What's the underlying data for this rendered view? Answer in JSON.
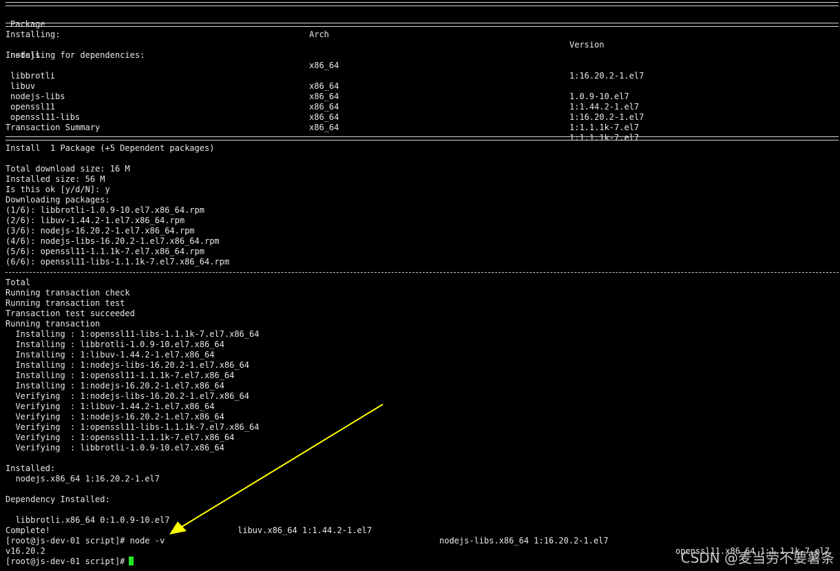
{
  "header": {
    "package": "Package",
    "arch": "Arch",
    "version": "Version"
  },
  "installing_label": "Installing:",
  "main_pkg": {
    "name": "nodejs",
    "arch": "x86_64",
    "version": "1:16.20.2-1.el7"
  },
  "deps_label": "Installing for dependencies:",
  "deps": [
    {
      "name": "libbrotli",
      "arch": "x86_64",
      "version": "1.0.9-10.el7"
    },
    {
      "name": "libuv",
      "arch": "x86_64",
      "version": "1:1.44.2-1.el7"
    },
    {
      "name": "nodejs-libs",
      "arch": "x86_64",
      "version": "1:16.20.2-1.el7"
    },
    {
      "name": "openssl11",
      "arch": "x86_64",
      "version": "1:1.1.1k-7.el7"
    },
    {
      "name": "openssl11-libs",
      "arch": "x86_64",
      "version": "1:1.1.1k-7.el7"
    }
  ],
  "txn_summary": "Transaction Summary",
  "install_line": "Install  1 Package (+5 Dependent packages)",
  "total_download": "Total download size: 16 M",
  "installed_size": "Installed size: 56 M",
  "is_ok": "Is this ok [y/d/N]: y",
  "downloading": "Downloading packages:",
  "downloads": [
    "(1/6): libbrotli-1.0.9-10.el7.x86_64.rpm",
    "(2/6): libuv-1.44.2-1.el7.x86_64.rpm",
    "(3/6): nodejs-16.20.2-1.el7.x86_64.rpm",
    "(4/6): nodejs-libs-16.20.2-1.el7.x86_64.rpm",
    "(5/6): openssl11-1.1.1k-7.el7.x86_64.rpm",
    "(6/6): openssl11-libs-1.1.1k-7.el7.x86_64.rpm"
  ],
  "total": "Total",
  "txn_lines": [
    "Running transaction check",
    "Running transaction test",
    "Transaction test succeeded",
    "Running transaction"
  ],
  "steps": [
    "  Installing : 1:openssl11-libs-1.1.1k-7.el7.x86_64",
    "  Installing : libbrotli-1.0.9-10.el7.x86_64",
    "  Installing : 1:libuv-1.44.2-1.el7.x86_64",
    "  Installing : 1:nodejs-libs-16.20.2-1.el7.x86_64",
    "  Installing : 1:openssl11-1.1.1k-7.el7.x86_64",
    "  Installing : 1:nodejs-16.20.2-1.el7.x86_64",
    "  Verifying  : 1:nodejs-libs-16.20.2-1.el7.x86_64",
    "  Verifying  : 1:libuv-1.44.2-1.el7.x86_64",
    "  Verifying  : 1:nodejs-16.20.2-1.el7.x86_64",
    "  Verifying  : 1:openssl11-libs-1.1.1k-7.el7.x86_64",
    "  Verifying  : 1:openssl11-1.1.1k-7.el7.x86_64",
    "  Verifying  : libbrotli-1.0.9-10.el7.x86_64"
  ],
  "installed_label": "Installed:",
  "installed_pkg": "  nodejs.x86_64 1:16.20.2-1.el7",
  "dep_installed_label": "Dependency Installed:",
  "dep_installed": [
    "  libbrotli.x86_64 0:1.0.9-10.el7",
    "libuv.x86_64 1:1.44.2-1.el7",
    "nodejs-libs.x86_64 1:16.20.2-1.el7",
    "openssl11.x86_64 1:1.1.1k-7.el7"
  ],
  "complete": "Complete!",
  "cmd_line": "[root@js-dev-01 script]# node -v",
  "output": "v16.20.2",
  "prompt": "[root@js-dev-01 script]#",
  "watermark": "CSDN @麦当劳不要薯条",
  "colors": {
    "background": "#000000",
    "text": "#e8e8e8",
    "cursor": "#22e822",
    "arrow": "#ffff00"
  }
}
